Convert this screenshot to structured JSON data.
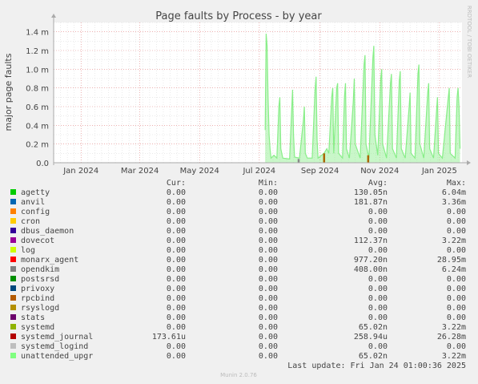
{
  "chart_data": {
    "type": "area",
    "title": "Page faults by Process - by year",
    "ylabel": "major page faults",
    "side_label": "RRDTOOL / TOBI OETIKER",
    "y_ticks": [
      "0.0",
      "0.2 m",
      "0.4 m",
      "0.6 m",
      "0.8 m",
      "1.0 m",
      "1.2 m",
      "1.4 m"
    ],
    "y_tick_values": [
      0,
      0.2,
      0.4,
      0.6,
      0.8,
      1.0,
      1.2,
      1.4
    ],
    "ylim": [
      0,
      1.5
    ],
    "y_unit": "m",
    "x_ticks": [
      "Jan 2024",
      "Mar 2024",
      "May 2024",
      "Jul 2024",
      "Sep 2024",
      "Nov 2024",
      "Jan 2025"
    ],
    "xlim": [
      "2023-12-04",
      "2025-01-24"
    ],
    "x_tick_dates": [
      "2024-01-01",
      "2024-03-01",
      "2024-05-01",
      "2024-07-01",
      "2024-09-01",
      "2024-11-01",
      "2025-01-01"
    ],
    "grid": true,
    "colors": {
      "unattended_upgr": "#88ee88",
      "opendkim": "#888888",
      "rsyslogd": "#bb8800",
      "rpcbind": "#aa6600",
      "grid_major": "#e08080",
      "grid_minor": "#dddddd",
      "axis": "#aaaaaa",
      "text": "#444444"
    },
    "series": [
      {
        "name": "unattended_upgr",
        "color": "#88ee88",
        "points": [
          [
            "2024-07-07",
            0.35
          ],
          [
            "2024-07-08",
            1.38
          ],
          [
            "2024-07-09",
            1.25
          ],
          [
            "2024-07-10",
            0.7
          ],
          [
            "2024-07-11",
            0.3
          ],
          [
            "2024-07-12",
            0.15
          ],
          [
            "2024-07-13",
            0.05
          ],
          [
            "2024-07-16",
            0.08
          ],
          [
            "2024-07-19",
            0.05
          ],
          [
            "2024-07-21",
            0.6
          ],
          [
            "2024-07-22",
            0.7
          ],
          [
            "2024-07-23",
            0.15
          ],
          [
            "2024-07-25",
            0.05
          ],
          [
            "2024-08-01",
            0.04
          ],
          [
            "2024-08-03",
            0.55
          ],
          [
            "2024-08-04",
            0.78
          ],
          [
            "2024-08-05",
            0.3
          ],
          [
            "2024-08-06",
            0.06
          ],
          [
            "2024-08-11",
            0.05
          ],
          [
            "2024-08-15",
            0.45
          ],
          [
            "2024-08-16",
            0.6
          ],
          [
            "2024-08-17",
            0.1
          ],
          [
            "2024-08-19",
            0.05
          ],
          [
            "2024-08-24",
            0.05
          ],
          [
            "2024-08-27",
            0.78
          ],
          [
            "2024-08-28",
            0.92
          ],
          [
            "2024-08-29",
            0.25
          ],
          [
            "2024-08-30",
            0.05
          ],
          [
            "2024-09-05",
            0.1
          ],
          [
            "2024-09-08",
            0.15
          ],
          [
            "2024-09-10",
            0.1
          ],
          [
            "2024-09-13",
            0.7
          ],
          [
            "2024-09-14",
            0.8
          ],
          [
            "2024-09-15",
            0.1
          ],
          [
            "2024-09-18",
            0.8
          ],
          [
            "2024-09-19",
            0.85
          ],
          [
            "2024-09-20",
            0.1
          ],
          [
            "2024-09-24",
            0.05
          ],
          [
            "2024-09-26",
            0.7
          ],
          [
            "2024-09-27",
            0.85
          ],
          [
            "2024-09-28",
            0.15
          ],
          [
            "2024-10-01",
            0.05
          ],
          [
            "2024-10-05",
            0.65
          ],
          [
            "2024-10-06",
            0.9
          ],
          [
            "2024-10-07",
            0.2
          ],
          [
            "2024-10-12",
            0.05
          ],
          [
            "2024-10-16",
            1.05
          ],
          [
            "2024-10-17",
            1.15
          ],
          [
            "2024-10-18",
            0.2
          ],
          [
            "2024-10-21",
            0.05
          ],
          [
            "2024-10-25",
            1.12
          ],
          [
            "2024-10-26",
            1.25
          ],
          [
            "2024-10-27",
            0.3
          ],
          [
            "2024-10-30",
            0.08
          ],
          [
            "2024-11-02",
            0.9
          ],
          [
            "2024-11-03",
            1.0
          ],
          [
            "2024-11-04",
            0.2
          ],
          [
            "2024-11-08",
            0.05
          ],
          [
            "2024-11-12",
            0.85
          ],
          [
            "2024-11-13",
            0.95
          ],
          [
            "2024-11-14",
            0.15
          ],
          [
            "2024-11-18",
            0.05
          ],
          [
            "2024-11-21",
            0.88
          ],
          [
            "2024-11-22",
            0.98
          ],
          [
            "2024-11-23",
            0.15
          ],
          [
            "2024-11-27",
            0.05
          ],
          [
            "2024-12-01",
            0.6
          ],
          [
            "2024-12-02",
            0.75
          ],
          [
            "2024-12-03",
            0.1
          ],
          [
            "2024-12-07",
            0.05
          ],
          [
            "2024-12-10",
            0.95
          ],
          [
            "2024-12-11",
            1.05
          ],
          [
            "2024-12-12",
            0.2
          ],
          [
            "2024-12-16",
            0.05
          ],
          [
            "2024-12-20",
            0.75
          ],
          [
            "2024-12-21",
            0.85
          ],
          [
            "2024-12-22",
            0.15
          ],
          [
            "2024-12-26",
            0.05
          ],
          [
            "2024-12-29",
            0.55
          ],
          [
            "2024-12-30",
            0.7
          ],
          [
            "2024-12-31",
            0.1
          ],
          [
            "2025-01-04",
            0.05
          ],
          [
            "2025-01-10",
            0.7
          ],
          [
            "2025-01-11",
            0.8
          ],
          [
            "2025-01-12",
            0.1
          ],
          [
            "2025-01-17",
            0.05
          ],
          [
            "2025-01-19",
            0.7
          ],
          [
            "2025-01-20",
            0.8
          ],
          [
            "2025-01-21",
            0.6
          ],
          [
            "2025-01-22",
            0.15
          ]
        ]
      }
    ],
    "small_marks": [
      {
        "color": "#aa6600",
        "date": "2024-09-05",
        "value": 0.1
      },
      {
        "color": "#aa6600",
        "date": "2024-10-20",
        "value": 0.08
      },
      {
        "color": "#888888",
        "date": "2024-08-10",
        "value": 0.04
      }
    ]
  },
  "legend": {
    "headers": {
      "cur": "Cur:",
      "min": "Min:",
      "avg": "Avg:",
      "max": "Max:"
    },
    "rows": [
      {
        "name": "agetty",
        "color": "#00cc00",
        "cur": "0.00",
        "min": "0.00",
        "avg": "130.05n",
        "max": "6.04m"
      },
      {
        "name": "anvil",
        "color": "#0066b3",
        "cur": "0.00",
        "min": "0.00",
        "avg": "181.87n",
        "max": "3.36m"
      },
      {
        "name": "config",
        "color": "#ff8000",
        "cur": "0.00",
        "min": "0.00",
        "avg": "0.00",
        "max": "0.00"
      },
      {
        "name": "cron",
        "color": "#ffcc00",
        "cur": "0.00",
        "min": "0.00",
        "avg": "0.00",
        "max": "0.00"
      },
      {
        "name": "dbus_daemon",
        "color": "#330099",
        "cur": "0.00",
        "min": "0.00",
        "avg": "0.00",
        "max": "0.00"
      },
      {
        "name": "dovecot",
        "color": "#990099",
        "cur": "0.00",
        "min": "0.00",
        "avg": "112.37n",
        "max": "3.22m"
      },
      {
        "name": "log",
        "color": "#ccff00",
        "cur": "0.00",
        "min": "0.00",
        "avg": "0.00",
        "max": "0.00"
      },
      {
        "name": "monarx_agent",
        "color": "#ff0000",
        "cur": "0.00",
        "min": "0.00",
        "avg": "977.20n",
        "max": "28.95m"
      },
      {
        "name": "opendkim",
        "color": "#808080",
        "cur": "0.00",
        "min": "0.00",
        "avg": "408.00n",
        "max": "6.24m"
      },
      {
        "name": "postsrsd",
        "color": "#008f00",
        "cur": "0.00",
        "min": "0.00",
        "avg": "0.00",
        "max": "0.00"
      },
      {
        "name": "privoxy",
        "color": "#00487d",
        "cur": "0.00",
        "min": "0.00",
        "avg": "0.00",
        "max": "0.00"
      },
      {
        "name": "rpcbind",
        "color": "#b35a00",
        "cur": "0.00",
        "min": "0.00",
        "avg": "0.00",
        "max": "0.00"
      },
      {
        "name": "rsyslogd",
        "color": "#b38f00",
        "cur": "0.00",
        "min": "0.00",
        "avg": "0.00",
        "max": "0.00"
      },
      {
        "name": "stats",
        "color": "#6b006b",
        "cur": "0.00",
        "min": "0.00",
        "avg": "0.00",
        "max": "0.00"
      },
      {
        "name": "systemd",
        "color": "#8fb300",
        "cur": "0.00",
        "min": "0.00",
        "avg": "65.02n",
        "max": "3.22m"
      },
      {
        "name": "systemd_journal",
        "color": "#b30000",
        "cur": "173.61u",
        "min": "0.00",
        "avg": "258.94u",
        "max": "26.28m"
      },
      {
        "name": "systemd_logind",
        "color": "#bebebe",
        "cur": "0.00",
        "min": "0.00",
        "avg": "0.00",
        "max": "0.00"
      },
      {
        "name": "unattended_upgr",
        "color": "#80ff80",
        "cur": "0.00",
        "min": "0.00",
        "avg": "65.02n",
        "max": "3.22m"
      }
    ]
  },
  "footer": {
    "last_update": "Last update: Fri Jan 24 01:00:36 2025",
    "version": "Munin 2.0.76"
  }
}
